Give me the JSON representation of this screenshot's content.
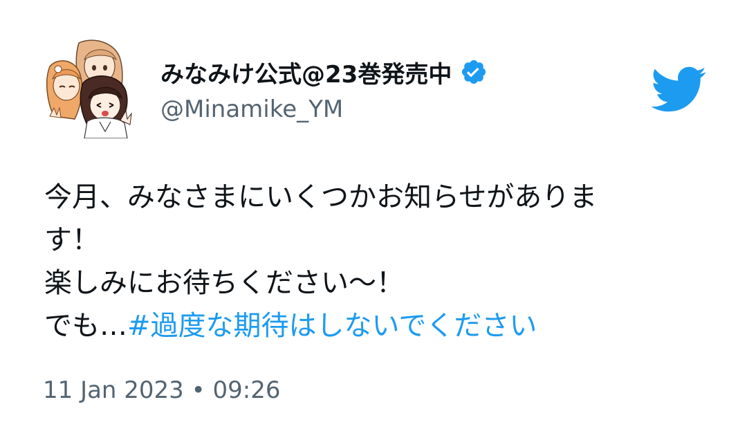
{
  "tweet": {
    "author": {
      "display_name": "みなみけ公式@23巻発売中",
      "handle": "@Minamike_YM",
      "verified": true,
      "avatar_icon": "manga-characters-avatar"
    },
    "brand_icon": "twitter-bird-icon",
    "colors": {
      "brand": "#1d9bf0",
      "text": "#0f1419",
      "muted": "#536471"
    },
    "body": {
      "line1": "今月、みなさまにいくつかお知らせがありま",
      "line2": "す！",
      "line3": "楽しみにお待ちください〜！",
      "line4_prefix": "でも…",
      "hashtag": "#過度な期待はしないでください"
    },
    "timestamp": "11 Jan 2023 • 09:26"
  }
}
